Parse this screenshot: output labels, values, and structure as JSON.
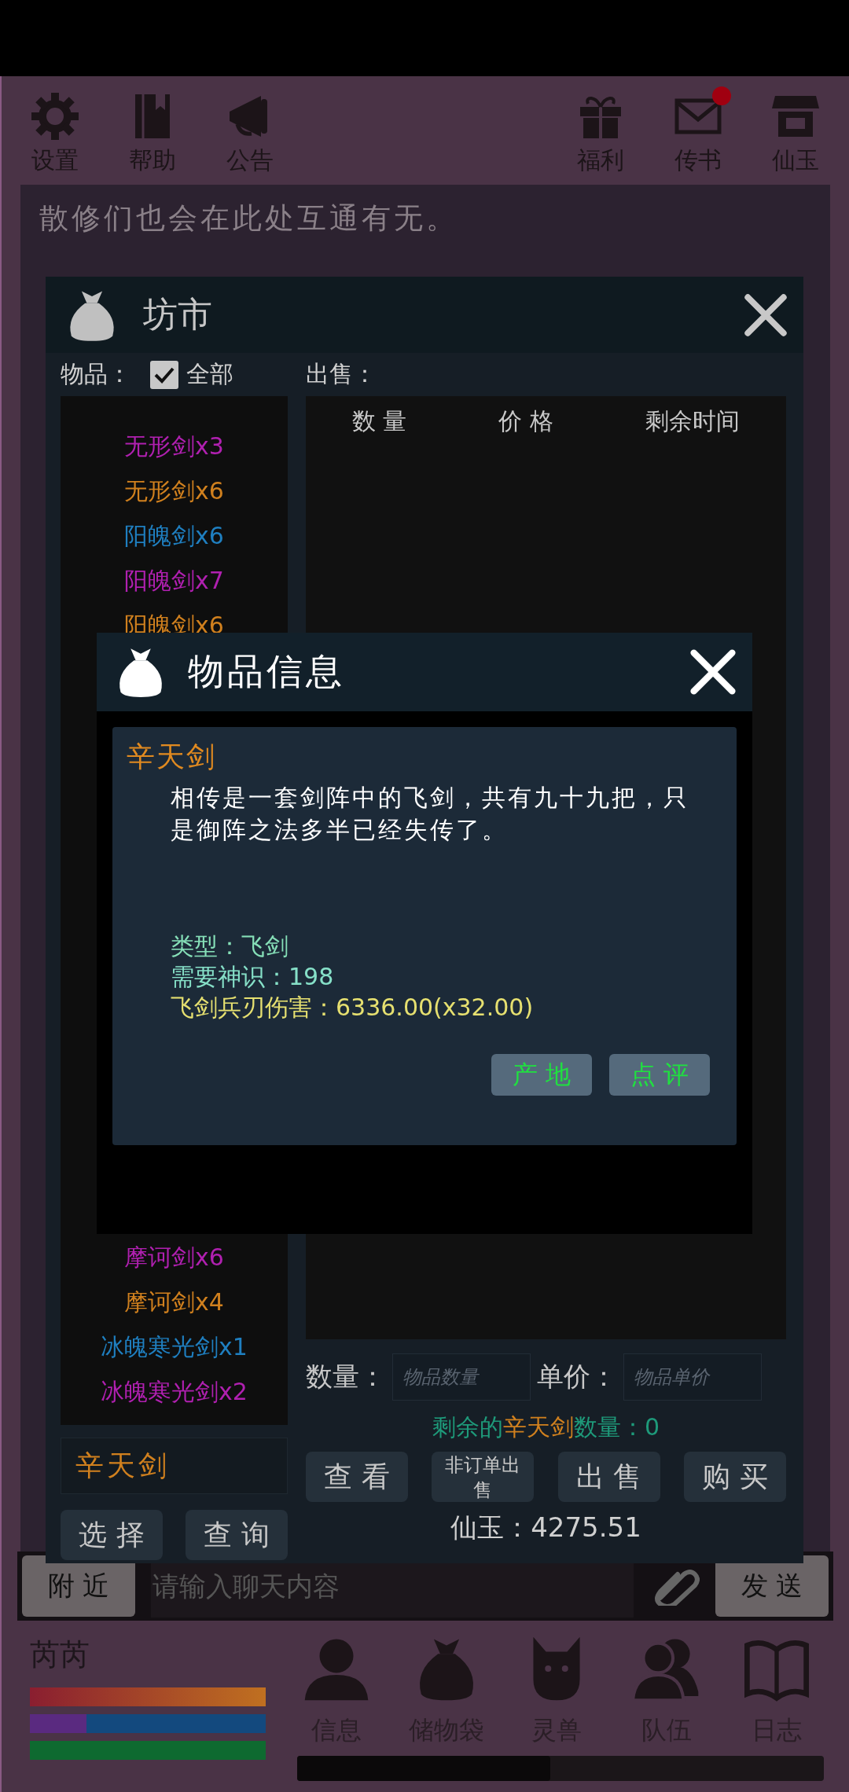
{
  "top_bar": {
    "left": [
      {
        "kind": "gear",
        "label": "设置"
      },
      {
        "kind": "book",
        "label": "帮助"
      },
      {
        "kind": "megaphone",
        "label": "公告"
      }
    ],
    "right": [
      {
        "kind": "gift",
        "label": "福利",
        "badge": false
      },
      {
        "kind": "mail",
        "label": "传书",
        "badge": true
      },
      {
        "kind": "shop",
        "label": "仙玉",
        "badge": false
      }
    ]
  },
  "notice": "散修们也会在此处互通有无。",
  "market": {
    "title": "坊市",
    "filter_label": "物品：",
    "all_checkbox": {
      "label": "全部",
      "checked": true
    },
    "sell_label": "出售：",
    "columns": [
      "数 量",
      "价 格",
      "剩余时间"
    ],
    "items_top": [
      {
        "name": "无形剑x3",
        "color": "#b020b0"
      },
      {
        "name": "无形剑x6",
        "color": "#d0801e"
      },
      {
        "name": "阳魄剑x6",
        "color": "#1f7fc0"
      },
      {
        "name": "阳魄剑x7",
        "color": "#b020b0"
      },
      {
        "name": "阳魄剑x6",
        "color": "#d0801e"
      }
    ],
    "items_bottom": [
      {
        "name": "摩诃剑x6",
        "color": "#b020b0"
      },
      {
        "name": "摩诃剑x4",
        "color": "#d0801e"
      },
      {
        "name": "冰魄寒光剑x1",
        "color": "#1f7fc0"
      },
      {
        "name": "冰魄寒光剑x2",
        "color": "#b020b0"
      }
    ],
    "search_value": "辛天剑",
    "left_buttons": [
      "选 择",
      "查 询"
    ],
    "quantity_label": "数量：",
    "quantity_placeholder": "物品数量",
    "price_label": "单价：",
    "price_placeholder": "物品单价",
    "remaining": {
      "prefix": "剩余的",
      "item": "辛天剑",
      "suffix": "数量：0"
    },
    "actions": [
      "查 看",
      "非订单出售",
      "出 售",
      "购 买"
    ],
    "balance": "仙玉：4275.51"
  },
  "item_info": {
    "title": "物品信息",
    "name": "辛天剑",
    "description": "相传是一套剑阵中的飞剑，共有九十九把，只是御阵之法多半已经失传了。",
    "stats": [
      {
        "text": "类型：飞剑",
        "color": "#86e0b8"
      },
      {
        "text": "需要神识：198",
        "color": "#86e0c8"
      },
      {
        "text": "飞剑兵刃伤害：6336.00(x32.00)",
        "color": "#e6e070"
      }
    ],
    "buttons": [
      "产 地",
      "点 评"
    ]
  },
  "chat": {
    "channel": "附 近",
    "placeholder": "请输入聊天内容",
    "send": "发 送"
  },
  "player": {
    "name": "芮芮",
    "bars": [
      {
        "kind": "health",
        "level": 1
      },
      {
        "kind": "mana",
        "level": 0.24
      },
      {
        "kind": "stamina",
        "level": 1
      }
    ]
  },
  "nav": [
    {
      "kind": "person",
      "label": "信息"
    },
    {
      "kind": "bag",
      "label": "储物袋"
    },
    {
      "kind": "cat",
      "label": "灵兽"
    },
    {
      "kind": "team",
      "label": "队伍"
    },
    {
      "kind": "book",
      "label": "日志"
    }
  ]
}
